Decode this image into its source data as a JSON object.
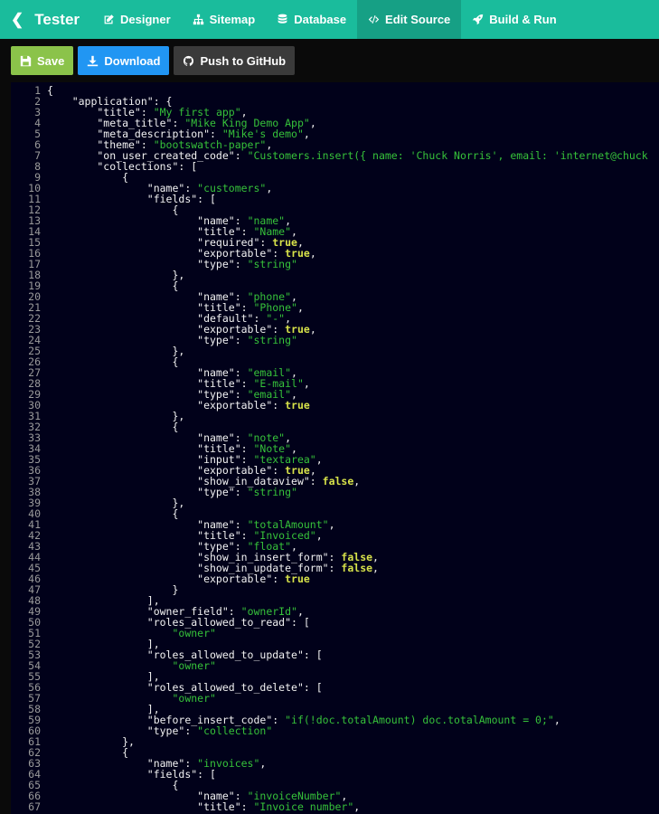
{
  "navbar": {
    "brand": "Tester",
    "items": [
      {
        "label": "Designer",
        "icon": "pencil-square-icon",
        "active": false
      },
      {
        "label": "Sitemap",
        "icon": "sitemap-icon",
        "active": false
      },
      {
        "label": "Database",
        "icon": "database-icon",
        "active": false
      },
      {
        "label": "Edit Source",
        "icon": "code-icon",
        "active": true
      },
      {
        "label": "Build & Run",
        "icon": "rocket-icon",
        "active": false
      }
    ],
    "color": "#1abc9c",
    "active_color": "#16a085"
  },
  "toolbar": {
    "save_label": "Save",
    "download_label": "Download",
    "github_label": "Push to GitHub"
  },
  "editor": {
    "lines": [
      [
        [
          "k",
          "{"
        ]
      ],
      [
        [
          "k",
          "    \"application\": {"
        ]
      ],
      [
        [
          "k",
          "        \"title\": "
        ],
        [
          "s",
          "\"My first app\""
        ],
        [
          "k",
          ","
        ]
      ],
      [
        [
          "k",
          "        \"meta_title\": "
        ],
        [
          "s",
          "\"Mike King Demo App\""
        ],
        [
          "k",
          ","
        ]
      ],
      [
        [
          "k",
          "        \"meta_description\": "
        ],
        [
          "s",
          "\"Mike's demo\""
        ],
        [
          "k",
          ","
        ]
      ],
      [
        [
          "k",
          "        \"theme\": "
        ],
        [
          "s",
          "\"bootswatch-paper\""
        ],
        [
          "k",
          ","
        ]
      ],
      [
        [
          "k",
          "        \"on_user_created_code\": "
        ],
        [
          "s",
          "\"Customers.insert({ name: 'Chuck Norris', email: 'internet@chuck"
        ]
      ],
      [
        [
          "k",
          "        \"collections\": ["
        ]
      ],
      [
        [
          "k",
          "            {"
        ]
      ],
      [
        [
          "k",
          "                \"name\": "
        ],
        [
          "s",
          "\"customers\""
        ],
        [
          "k",
          ","
        ]
      ],
      [
        [
          "k",
          "                \"fields\": ["
        ]
      ],
      [
        [
          "k",
          "                    {"
        ]
      ],
      [
        [
          "k",
          "                        \"name\": "
        ],
        [
          "s",
          "\"name\""
        ],
        [
          "k",
          ","
        ]
      ],
      [
        [
          "k",
          "                        \"title\": "
        ],
        [
          "s",
          "\"Name\""
        ],
        [
          "k",
          ","
        ]
      ],
      [
        [
          "k",
          "                        \"required\": "
        ],
        [
          "b",
          "true"
        ],
        [
          "k",
          ","
        ]
      ],
      [
        [
          "k",
          "                        \"exportable\": "
        ],
        [
          "b",
          "true"
        ],
        [
          "k",
          ","
        ]
      ],
      [
        [
          "k",
          "                        \"type\": "
        ],
        [
          "s",
          "\"string\""
        ]
      ],
      [
        [
          "k",
          "                    },"
        ]
      ],
      [
        [
          "k",
          "                    {"
        ]
      ],
      [
        [
          "k",
          "                        \"name\": "
        ],
        [
          "s",
          "\"phone\""
        ],
        [
          "k",
          ","
        ]
      ],
      [
        [
          "k",
          "                        \"title\": "
        ],
        [
          "s",
          "\"Phone\""
        ],
        [
          "k",
          ","
        ]
      ],
      [
        [
          "k",
          "                        \"default\": "
        ],
        [
          "s",
          "\"-\""
        ],
        [
          "k",
          ","
        ]
      ],
      [
        [
          "k",
          "                        \"exportable\": "
        ],
        [
          "b",
          "true"
        ],
        [
          "k",
          ","
        ]
      ],
      [
        [
          "k",
          "                        \"type\": "
        ],
        [
          "s",
          "\"string\""
        ]
      ],
      [
        [
          "k",
          "                    },"
        ]
      ],
      [
        [
          "k",
          "                    {"
        ]
      ],
      [
        [
          "k",
          "                        \"name\": "
        ],
        [
          "s",
          "\"email\""
        ],
        [
          "k",
          ","
        ]
      ],
      [
        [
          "k",
          "                        \"title\": "
        ],
        [
          "s",
          "\"E-mail\""
        ],
        [
          "k",
          ","
        ]
      ],
      [
        [
          "k",
          "                        \"type\": "
        ],
        [
          "s",
          "\"email\""
        ],
        [
          "k",
          ","
        ]
      ],
      [
        [
          "k",
          "                        \"exportable\": "
        ],
        [
          "b",
          "true"
        ]
      ],
      [
        [
          "k",
          "                    },"
        ]
      ],
      [
        [
          "k",
          "                    {"
        ]
      ],
      [
        [
          "k",
          "                        \"name\": "
        ],
        [
          "s",
          "\"note\""
        ],
        [
          "k",
          ","
        ]
      ],
      [
        [
          "k",
          "                        \"title\": "
        ],
        [
          "s",
          "\"Note\""
        ],
        [
          "k",
          ","
        ]
      ],
      [
        [
          "k",
          "                        \"input\": "
        ],
        [
          "s",
          "\"textarea\""
        ],
        [
          "k",
          ","
        ]
      ],
      [
        [
          "k",
          "                        \"exportable\": "
        ],
        [
          "b",
          "true"
        ],
        [
          "k",
          ","
        ]
      ],
      [
        [
          "k",
          "                        \"show_in_dataview\": "
        ],
        [
          "b",
          "false"
        ],
        [
          "k",
          ","
        ]
      ],
      [
        [
          "k",
          "                        \"type\": "
        ],
        [
          "s",
          "\"string\""
        ]
      ],
      [
        [
          "k",
          "                    },"
        ]
      ],
      [
        [
          "k",
          "                    {"
        ]
      ],
      [
        [
          "k",
          "                        \"name\": "
        ],
        [
          "s",
          "\"totalAmount\""
        ],
        [
          "k",
          ","
        ]
      ],
      [
        [
          "k",
          "                        \"title\": "
        ],
        [
          "s",
          "\"Invoiced\""
        ],
        [
          "k",
          ","
        ]
      ],
      [
        [
          "k",
          "                        \"type\": "
        ],
        [
          "s",
          "\"float\""
        ],
        [
          "k",
          ","
        ]
      ],
      [
        [
          "k",
          "                        \"show_in_insert_form\": "
        ],
        [
          "b",
          "false"
        ],
        [
          "k",
          ","
        ]
      ],
      [
        [
          "k",
          "                        \"show_in_update_form\": "
        ],
        [
          "b",
          "false"
        ],
        [
          "k",
          ","
        ]
      ],
      [
        [
          "k",
          "                        \"exportable\": "
        ],
        [
          "b",
          "true"
        ]
      ],
      [
        [
          "k",
          "                    }"
        ]
      ],
      [
        [
          "k",
          "                ],"
        ]
      ],
      [
        [
          "k",
          "                \"owner_field\": "
        ],
        [
          "s",
          "\"ownerId\""
        ],
        [
          "k",
          ","
        ]
      ],
      [
        [
          "k",
          "                \"roles_allowed_to_read\": ["
        ]
      ],
      [
        [
          "k",
          "                    "
        ],
        [
          "s",
          "\"owner\""
        ]
      ],
      [
        [
          "k",
          "                ],"
        ]
      ],
      [
        [
          "k",
          "                \"roles_allowed_to_update\": ["
        ]
      ],
      [
        [
          "k",
          "                    "
        ],
        [
          "s",
          "\"owner\""
        ]
      ],
      [
        [
          "k",
          "                ],"
        ]
      ],
      [
        [
          "k",
          "                \"roles_allowed_to_delete\": ["
        ]
      ],
      [
        [
          "k",
          "                    "
        ],
        [
          "s",
          "\"owner\""
        ]
      ],
      [
        [
          "k",
          "                ],"
        ]
      ],
      [
        [
          "k",
          "                \"before_insert_code\": "
        ],
        [
          "s",
          "\"if(!doc.totalAmount) doc.totalAmount = 0;\""
        ],
        [
          "k",
          ","
        ]
      ],
      [
        [
          "k",
          "                \"type\": "
        ],
        [
          "s",
          "\"collection\""
        ]
      ],
      [
        [
          "k",
          "            },"
        ]
      ],
      [
        [
          "k",
          "            {"
        ]
      ],
      [
        [
          "k",
          "                \"name\": "
        ],
        [
          "s",
          "\"invoices\""
        ],
        [
          "k",
          ","
        ]
      ],
      [
        [
          "k",
          "                \"fields\": ["
        ]
      ],
      [
        [
          "k",
          "                    {"
        ]
      ],
      [
        [
          "k",
          "                        \"name\": "
        ],
        [
          "s",
          "\"invoiceNumber\""
        ],
        [
          "k",
          ","
        ]
      ],
      [
        [
          "k",
          "                        \"title\": "
        ],
        [
          "s",
          "\"Invoice number\""
        ],
        [
          "k",
          ","
        ]
      ]
    ]
  }
}
